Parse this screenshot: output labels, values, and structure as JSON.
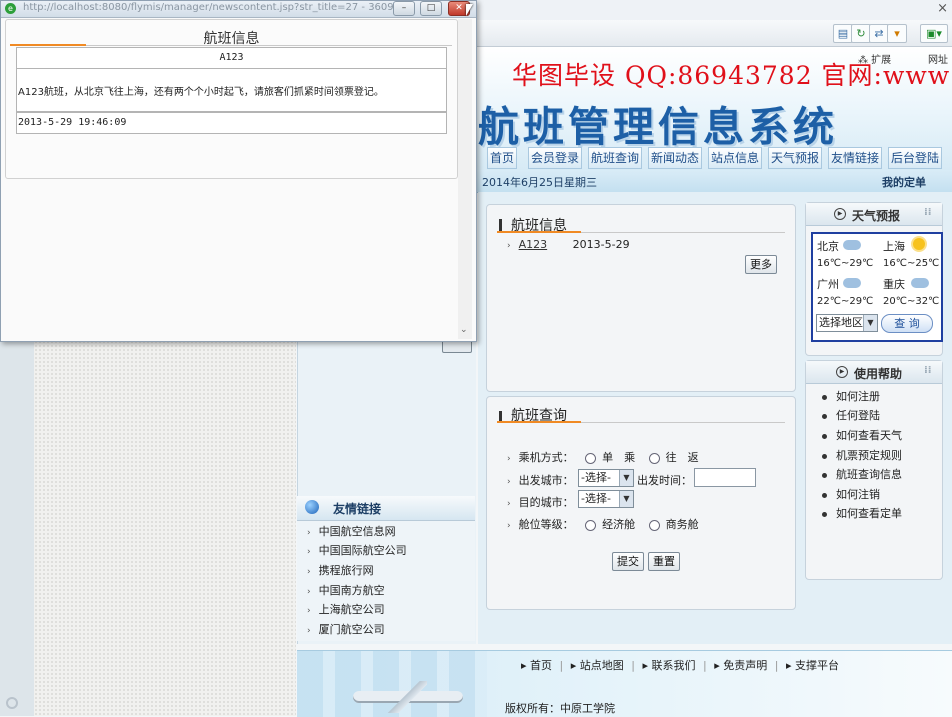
{
  "popup": {
    "url": "http://localhost:8080/flymis/manager/newscontent.jsp?str_title=27 - 3609",
    "title": "航班信息",
    "flight_no": "A123",
    "content": "A123航班，从北京飞往上海，还有两个个小时起飞，请旅客们抓紧时间领票登记。",
    "datetime": "2013-5-29 19:46:09",
    "buttons": {
      "minimize": "–",
      "maximize": "□",
      "close": "✕"
    }
  },
  "browser": {
    "close_tab": "×",
    "search_partial": "网址"
  },
  "ad_text": "华图毕设 QQ:86943782 官网:www",
  "site_title": "航班管理信息系统",
  "nav": [
    "首页",
    "会员登录",
    "航班查询",
    "新闻动态",
    "站点信息",
    "天气预报",
    "友情链接",
    "后台登陆"
  ],
  "date_line": "2014年6月25日星期三",
  "my_booking": "我的定单",
  "flight_info_panel": {
    "title": "航班信息",
    "items": [
      {
        "name": "A123",
        "date": "2013-5-29"
      }
    ],
    "more": "更多"
  },
  "flight_query": {
    "title": "航班查询",
    "labels": {
      "mode": "乘机方式：",
      "from": "出发城市：",
      "time": "出发时间：",
      "to": "目的城市：",
      "class": "舱位等级："
    },
    "mode_options": [
      "单　乘",
      "往　返"
    ],
    "select_placeholder": "-选择-",
    "class_options": [
      "经济舱",
      "商务舱"
    ],
    "submit": "提交",
    "reset": "重置"
  },
  "weather": {
    "title": "天气预报",
    "cities": [
      {
        "name": "北京",
        "temp": "16℃~29℃",
        "icon": "cloud-rain-icon"
      },
      {
        "name": "上海",
        "temp": "16℃~25℃",
        "icon": "sun-icon"
      },
      {
        "name": "广州",
        "temp": "22℃~29℃",
        "icon": "cloud-rain-icon"
      },
      {
        "name": "重庆",
        "temp": "20℃~32℃",
        "icon": "cloud-rain-icon"
      }
    ],
    "region_select": "选择地区",
    "query": "查 询"
  },
  "help": {
    "title": "使用帮助",
    "items": [
      "如何注册",
      "任何登陆",
      "如何查看天气",
      "机票预定规则",
      "航班查询信息",
      "如何注销",
      "如何查看定单"
    ]
  },
  "links": {
    "title": "友情链接",
    "items": [
      "中国航空信息网",
      "中国国际航空公司",
      "携程旅行网",
      "中国南方航空",
      "上海航空公司",
      "厦门航空公司"
    ]
  },
  "footer": {
    "links": [
      "首页",
      "站点地图",
      "联系我们",
      "免责声明",
      "支撑平台"
    ],
    "copyright": "版权所有：中原工学院"
  },
  "colors": {
    "accent": "#1d5fa6",
    "ad_red": "#e0101a",
    "orange": "#f08a24",
    "weather_border": "#1f3fa0"
  }
}
